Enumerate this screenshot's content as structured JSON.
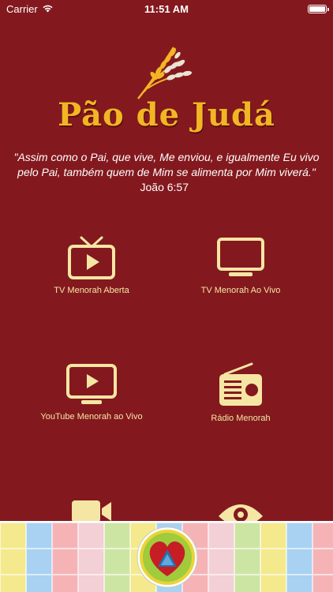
{
  "status_bar": {
    "carrier": "Carrier",
    "time": "11:51 AM",
    "wifi_icon": "wifi-icon",
    "battery_icon": "battery-icon"
  },
  "logo": {
    "text": "Pão de Judá",
    "icon": "wheat-icon",
    "colors": {
      "gold": "#f2b624",
      "background": "#83191e"
    }
  },
  "verse": {
    "quote": "\"Assim como o Pai, que vive, Me enviou, e igualmente Eu vivo pelo Pai, também quem de Mim se alimenta por Mim viverá.\"",
    "reference": "João 6:57"
  },
  "menu": [
    {
      "label": "TV Menorah Aberta",
      "icon": "tv-play-icon"
    },
    {
      "label": "TV Menorah Ao Vivo",
      "icon": "monitor-icon"
    },
    {
      "label": "YouTube Menorah ao Vivo",
      "icon": "youtube-play-icon"
    },
    {
      "label": "Rádio Menorah",
      "icon": "radio-icon"
    },
    {
      "label": "",
      "icon": "video-camera-icon"
    },
    {
      "label": "",
      "icon": "eye-icon"
    }
  ],
  "banner": {
    "icon": "heart-logo-icon",
    "tile_colors": [
      "#f4e98c",
      "#f6b3b6",
      "#cde5a3",
      "#a9d1f1",
      "#f3cfd6"
    ]
  }
}
